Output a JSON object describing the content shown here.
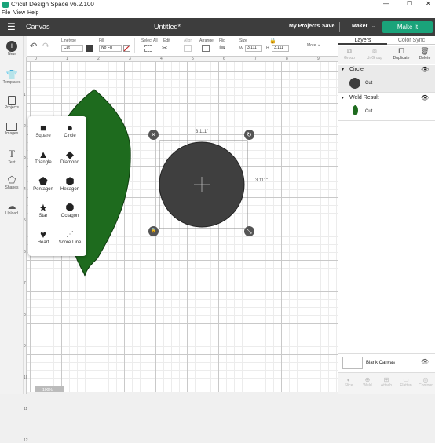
{
  "titlebar": {
    "title": "Cricut Design Space  v6.2.100",
    "min": "—",
    "max": "☐",
    "close": "✕"
  },
  "menu": {
    "file": "File",
    "view": "View",
    "help": "Help"
  },
  "header": {
    "canvas_label": "Canvas",
    "doc_title": "Untitled*",
    "my_projects": "My Projects",
    "save": "Save",
    "machine": "Maker",
    "make_it": "Make It"
  },
  "sidebar": {
    "new": "New",
    "templates": "Templates",
    "projects": "Projects",
    "images": "Images",
    "text": "Text",
    "shapes": "Shapes",
    "upload": "Upload"
  },
  "toolbar": {
    "linetype_label": "Linetype",
    "linetype_value": "Cut",
    "fill_label": "Fill",
    "fill_value": "No Fill",
    "select_all": "Select All",
    "edit": "Edit",
    "align": "Align",
    "arrange": "Arrange",
    "flip": "Flip",
    "size": "Size",
    "w_label": "W",
    "w_value": "3.111",
    "h_label": "H",
    "h_value": "3.111",
    "more": "More"
  },
  "ruler": {
    "top": [
      "0",
      "1",
      "2",
      "3",
      "4",
      "5",
      "6",
      "7",
      "8",
      "9",
      "10"
    ],
    "left": [
      "1",
      "2",
      "3",
      "4",
      "5",
      "6",
      "7",
      "8",
      "9",
      "10",
      "11",
      "12"
    ]
  },
  "selection": {
    "width_label": "3.111\"",
    "height_label": "3.111\""
  },
  "shapes_panel": {
    "items": [
      "Square",
      "Circle",
      "Triangle",
      "Diamond",
      "Pentagon",
      "Hexagon",
      "Star",
      "Octagon",
      "Heart",
      "Score Line"
    ]
  },
  "right_panel": {
    "tab_layers": "Layers",
    "tab_color_sync": "Color Sync",
    "actions": [
      "Group",
      "UnGroup",
      "Duplicate",
      "Delete"
    ],
    "layers": [
      {
        "name": "Circle",
        "op": "Cut",
        "color": "#3f3f3f"
      },
      {
        "name": "Weld Result",
        "op": "Cut",
        "color": "#1e6b1e"
      }
    ],
    "blank_canvas": "Blank Canvas",
    "bottom_actions": [
      "Slice",
      "Weld",
      "Attach",
      "Flatten",
      "Contour"
    ]
  },
  "zoom": {
    "value": "100%"
  },
  "colors": {
    "accent": "#1aa37a",
    "leaf": "#1e6b1e",
    "circle": "#3f3f3f",
    "header": "#3d3d3d"
  }
}
